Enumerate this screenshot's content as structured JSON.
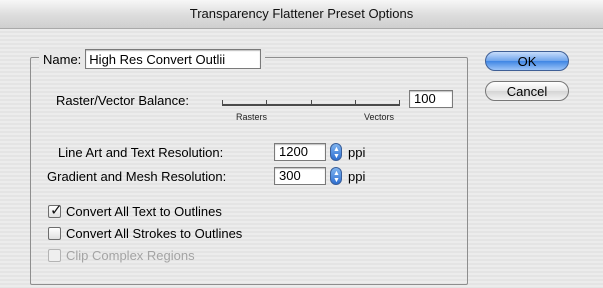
{
  "window": {
    "title": "Transparency Flattener Preset Options"
  },
  "name_field": {
    "label": "Name:",
    "value": "High Res Convert Outlii"
  },
  "balance": {
    "label": "Raster/Vector Balance:",
    "left_label": "Rasters",
    "right_label": "Vectors",
    "value": "100",
    "level_percent": 100
  },
  "line_art": {
    "label": "Line Art and Text Resolution:",
    "value": "1200",
    "unit": "ppi"
  },
  "gradient": {
    "label": "Gradient and Mesh Resolution:",
    "value": "300",
    "unit": "ppi"
  },
  "options": [
    {
      "label": "Convert All Text to Outlines",
      "checked": true,
      "enabled": true
    },
    {
      "label": "Convert All Strokes to Outlines",
      "checked": false,
      "enabled": true
    },
    {
      "label": "Clip Complex Regions",
      "checked": false,
      "enabled": false
    }
  ],
  "buttons": {
    "ok": "OK",
    "cancel": "Cancel"
  },
  "colors": {
    "default_button": "#3f86e4",
    "checkbox_checked": "#111111"
  }
}
